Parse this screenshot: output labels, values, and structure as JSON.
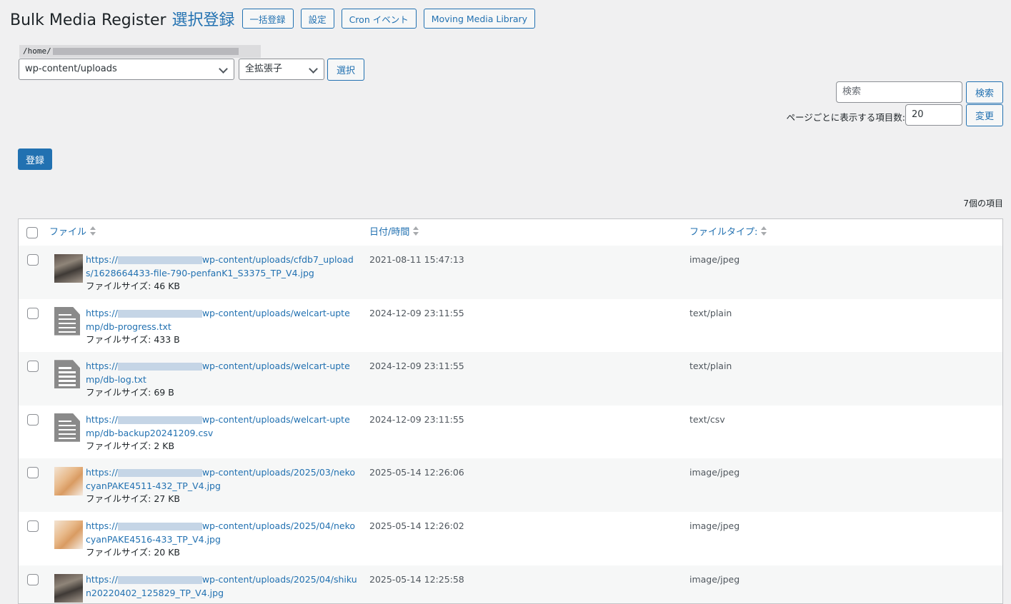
{
  "header": {
    "title": "Bulk Media Register",
    "subtitle": "選択登録",
    "buttons": [
      "一括登録",
      "設定",
      "Cron イベント",
      "Moving Media Library"
    ]
  },
  "path": {
    "prefix": "/home/"
  },
  "filters": {
    "directory": "wp-content/uploads",
    "extension": "全拡張子",
    "select_button": "選択"
  },
  "search": {
    "placeholder": "検索",
    "button": "検索"
  },
  "per_page": {
    "label": "ページごとに表示する項目数:",
    "value": "20",
    "button": "変更"
  },
  "register_button": "登録",
  "item_count": "7個の項目",
  "table": {
    "columns": [
      "ファイル",
      "日付/時間",
      "ファイルタイプ:"
    ],
    "size_label": "ファイルサイズ:",
    "rows": [
      {
        "url_start": "https://",
        "url_rest": "wp-content/uploads/cfdb7_uploads/1628664433-file-790-penfanK1_S3375_TP_V4.jpg",
        "size": "46 KB",
        "date": "2021-08-11 15:47:13",
        "type": "image/jpeg",
        "thumb": "photo-room"
      },
      {
        "url_start": "https://",
        "url_rest": "wp-content/uploads/welcart-uptemp/db-progress.txt",
        "size": "433 B",
        "date": "2024-12-09 23:11:55",
        "type": "text/plain",
        "thumb": "document-icon"
      },
      {
        "url_start": "https://",
        "url_rest": "wp-content/uploads/welcart-uptemp/db-log.txt",
        "size": "69 B",
        "date": "2024-12-09 23:11:55",
        "type": "text/plain",
        "thumb": "document-icon"
      },
      {
        "url_start": "https://",
        "url_rest": "wp-content/uploads/welcart-uptemp/db-backup20241209.csv",
        "size": "2 KB",
        "date": "2024-12-09 23:11:55",
        "type": "text/csv",
        "thumb": "document-icon"
      },
      {
        "url_start": "https://",
        "url_rest": "wp-content/uploads/2025/03/nekocyanPAKE4511-432_TP_V4.jpg",
        "size": "27 KB",
        "date": "2025-05-14 12:26:06",
        "type": "image/jpeg",
        "thumb": "photo-cat"
      },
      {
        "url_start": "https://",
        "url_rest": "wp-content/uploads/2025/04/nekocyanPAKE4516-433_TP_V4.jpg",
        "size": "20 KB",
        "date": "2025-05-14 12:26:02",
        "type": "image/jpeg",
        "thumb": "photo-cat"
      },
      {
        "url_start": "https://",
        "url_rest": "wp-content/uploads/2025/04/shikun20220402_125829_TP_V4.jpg",
        "size": "",
        "date": "2025-05-14 12:25:58",
        "type": "image/jpeg",
        "thumb": "photo-room"
      }
    ]
  },
  "colors": {
    "accent": "#2271b1",
    "background": "#f0f0f1",
    "text": "#1d2327"
  }
}
